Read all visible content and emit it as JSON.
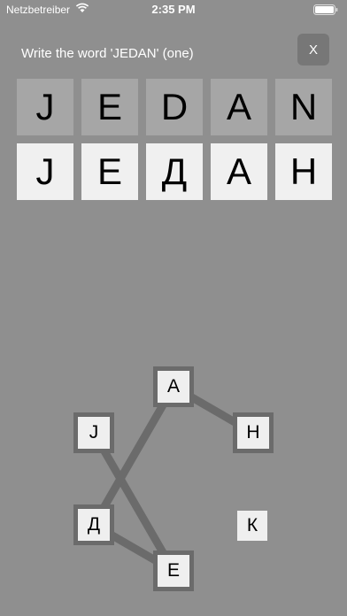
{
  "status_bar": {
    "carrier": "Netzbetreiber",
    "time": "2:35 PM"
  },
  "task": {
    "prompt": "Write the word 'JEDAN' (one)",
    "close_label": "X"
  },
  "latin_tiles": [
    "J",
    "E",
    "D",
    "A",
    "N"
  ],
  "cyrillic_tiles": [
    "J",
    "Е",
    "Д",
    "А",
    "Н"
  ],
  "letter_nodes": {
    "a": "А",
    "n": "Н",
    "j": "J",
    "d": "Д",
    "k": "К",
    "e": "Е"
  },
  "connections": [
    [
      "j",
      "e"
    ],
    [
      "e",
      "d"
    ],
    [
      "d",
      "a"
    ],
    [
      "a",
      "n"
    ]
  ],
  "colors": {
    "background": "#8f8f8f",
    "line": "#6b6b6b",
    "tile_light": "#f0f0f0",
    "tile_dark": "#a6a6a6"
  }
}
